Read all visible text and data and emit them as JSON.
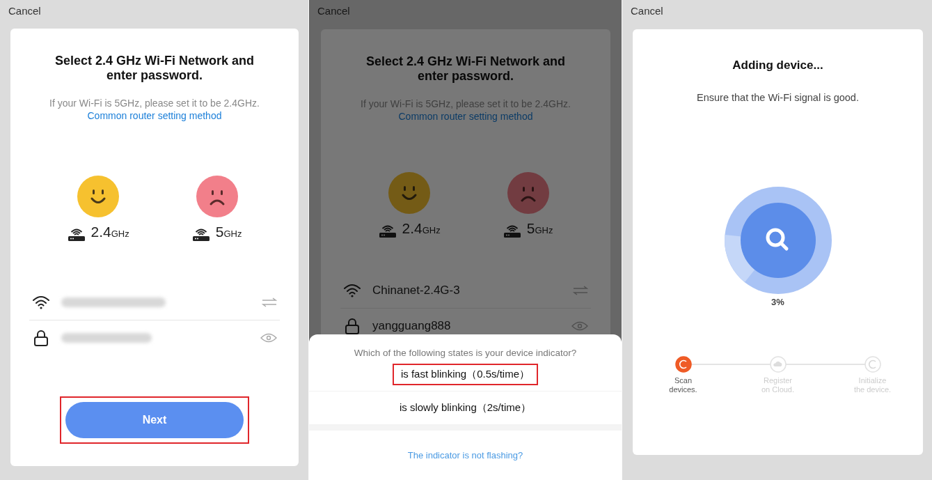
{
  "panels": [
    {
      "kind": "wifi_setup",
      "dimmed": false,
      "cancel": "Cancel",
      "title": "Select 2.4 GHz Wi-Fi Network and\nenter password.",
      "hint": "If your Wi-Fi is 5GHz, please set it to be 2.4GHz.",
      "link": "Common router setting method",
      "bands": [
        {
          "kind": "supported",
          "number": "2.4",
          "unit": "GHz"
        },
        {
          "kind": "unsupported",
          "number": "5",
          "unit": "GHz"
        }
      ],
      "fields": [
        {
          "kind": "network",
          "blurred": true
        },
        {
          "kind": "password",
          "blurred": true
        }
      ],
      "next_button": {
        "label": "Next",
        "highlighted": true
      }
    },
    {
      "kind": "wifi_setup",
      "dimmed": true,
      "cancel": "Cancel",
      "title": "Select 2.4 GHz Wi-Fi Network and\nenter password.",
      "hint": "If your Wi-Fi is 5GHz, please set it to be 2.4GHz.",
      "link": "Common router setting method",
      "bands": [
        {
          "kind": "supported",
          "number": "2.4",
          "unit": "GHz"
        },
        {
          "kind": "unsupported",
          "number": "5",
          "unit": "GHz"
        }
      ],
      "fields": [
        {
          "kind": "network",
          "blurred": false,
          "value": "Chinanet-2.4G-3"
        },
        {
          "kind": "password",
          "blurred": false,
          "value": "yangguang888"
        }
      ],
      "sheet": {
        "question": "Which of the following states is your device indicator?",
        "options": [
          {
            "label": "is fast blinking（0.5s/time）",
            "highlighted": true
          },
          {
            "label": "is slowly blinking（2s/time）",
            "highlighted": false
          }
        ],
        "link": "The indicator is not flashing?"
      }
    },
    {
      "kind": "adding",
      "cancel": "Cancel",
      "title": "Adding device...",
      "hint": "Ensure that the Wi-Fi signal is good.",
      "progress": {
        "reading": "3%"
      },
      "steps": [
        {
          "kind": "scan",
          "label": "Scan\ndevices.",
          "active": true
        },
        {
          "kind": "cloud",
          "label": "Register\non Cloud.",
          "active": false
        },
        {
          "kind": "init",
          "label": "Initialize\nthe device.",
          "active": false
        }
      ]
    }
  ]
}
